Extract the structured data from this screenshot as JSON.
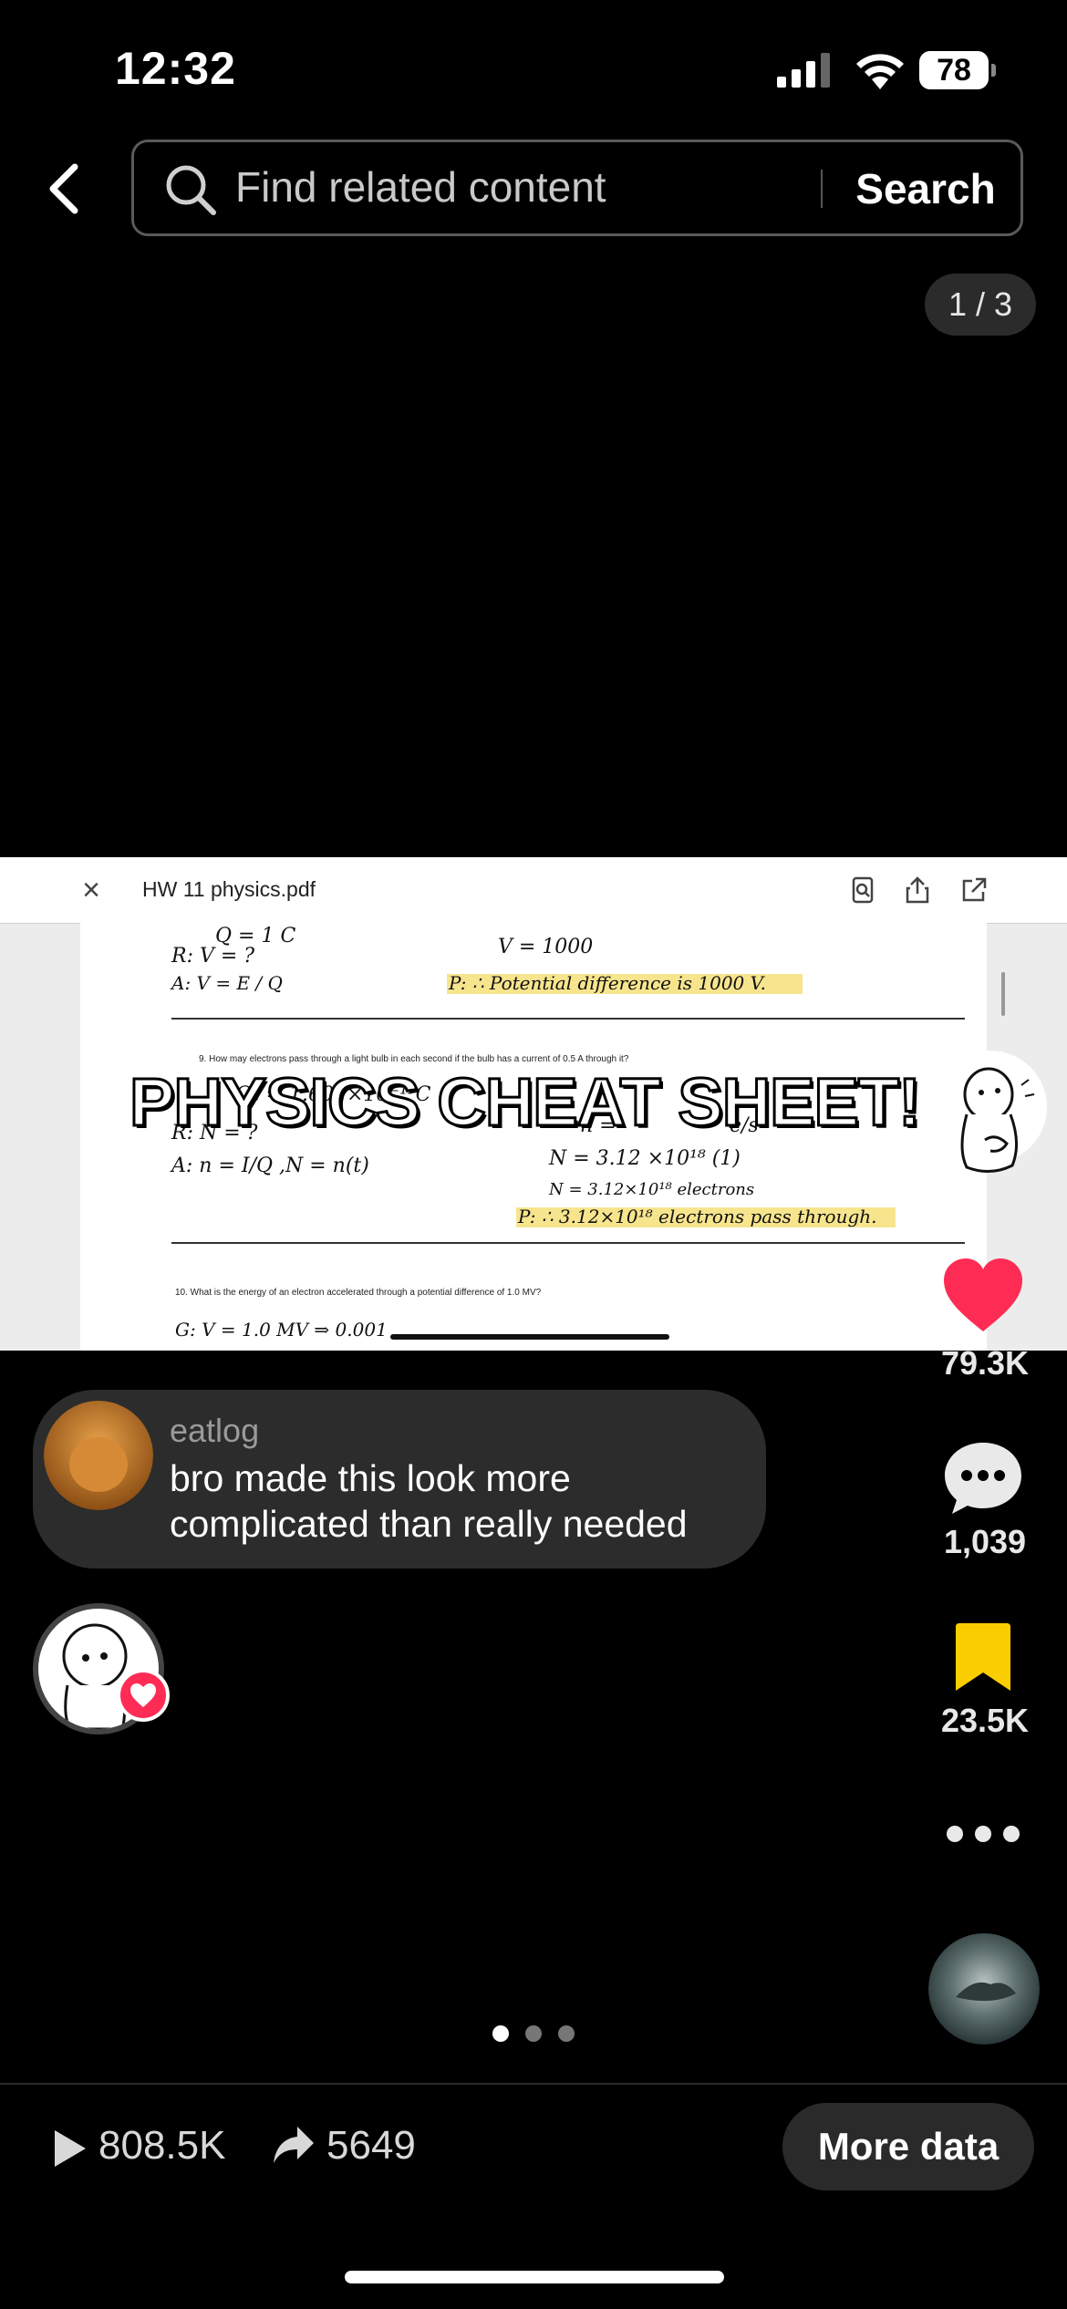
{
  "status_bar": {
    "time": "12:32",
    "battery": "78"
  },
  "header": {
    "search_placeholder": "Find related content",
    "search_button": "Search"
  },
  "page_counter": "1 / 3",
  "pdf_viewer": {
    "file_name": "HW 11 physics.pdf",
    "question_9": "9.  How may electrons pass through a light bulb in each second if the bulb has a current of 0.5 A through it?",
    "question_10": "10.  What is the energy of an electron accelerated through a potential difference of 1.0 MV?",
    "handwriting": {
      "q_line": "Q =  1 C",
      "r_line": "R:   V = ?",
      "a_line": "A:    V =  E / Q",
      "v_result": "V = 1000",
      "p_result": "P: ∴ Potential difference is 1000 V.",
      "qe_line": "Qₑ = 1.602×10⁻¹⁹C",
      "r2_line": "R:  N = ?",
      "a2_line": "A:     n = I/Q ,N = n(t)",
      "n_eq": "n =",
      "units": "e/s",
      "n1": "N = 3.12 ×10¹⁸ (1)",
      "n2": "N = 3.12×10¹⁸ electrons",
      "p2": "P: ∴ 3.12×10¹⁸ electrons pass through.",
      "g_line": "G:  V = 1.0 MV  ⇒  0.001"
    }
  },
  "video_overlay_text": "PHYSICS CHEAT SHEET!",
  "actions": {
    "likes": "79.3K",
    "comments": "1,039",
    "saves": "23.5K"
  },
  "top_comment": {
    "username": "eatlog",
    "text": "bro made this look more complicated than really needed"
  },
  "carousel": {
    "total": 3,
    "active": 0
  },
  "bottom_bar": {
    "views": "808.5K",
    "shares": "5649",
    "more_data": "More data"
  },
  "colors": {
    "like": "#fe2c55",
    "bookmark": "#facd00",
    "highlight": "#f7e58e"
  }
}
